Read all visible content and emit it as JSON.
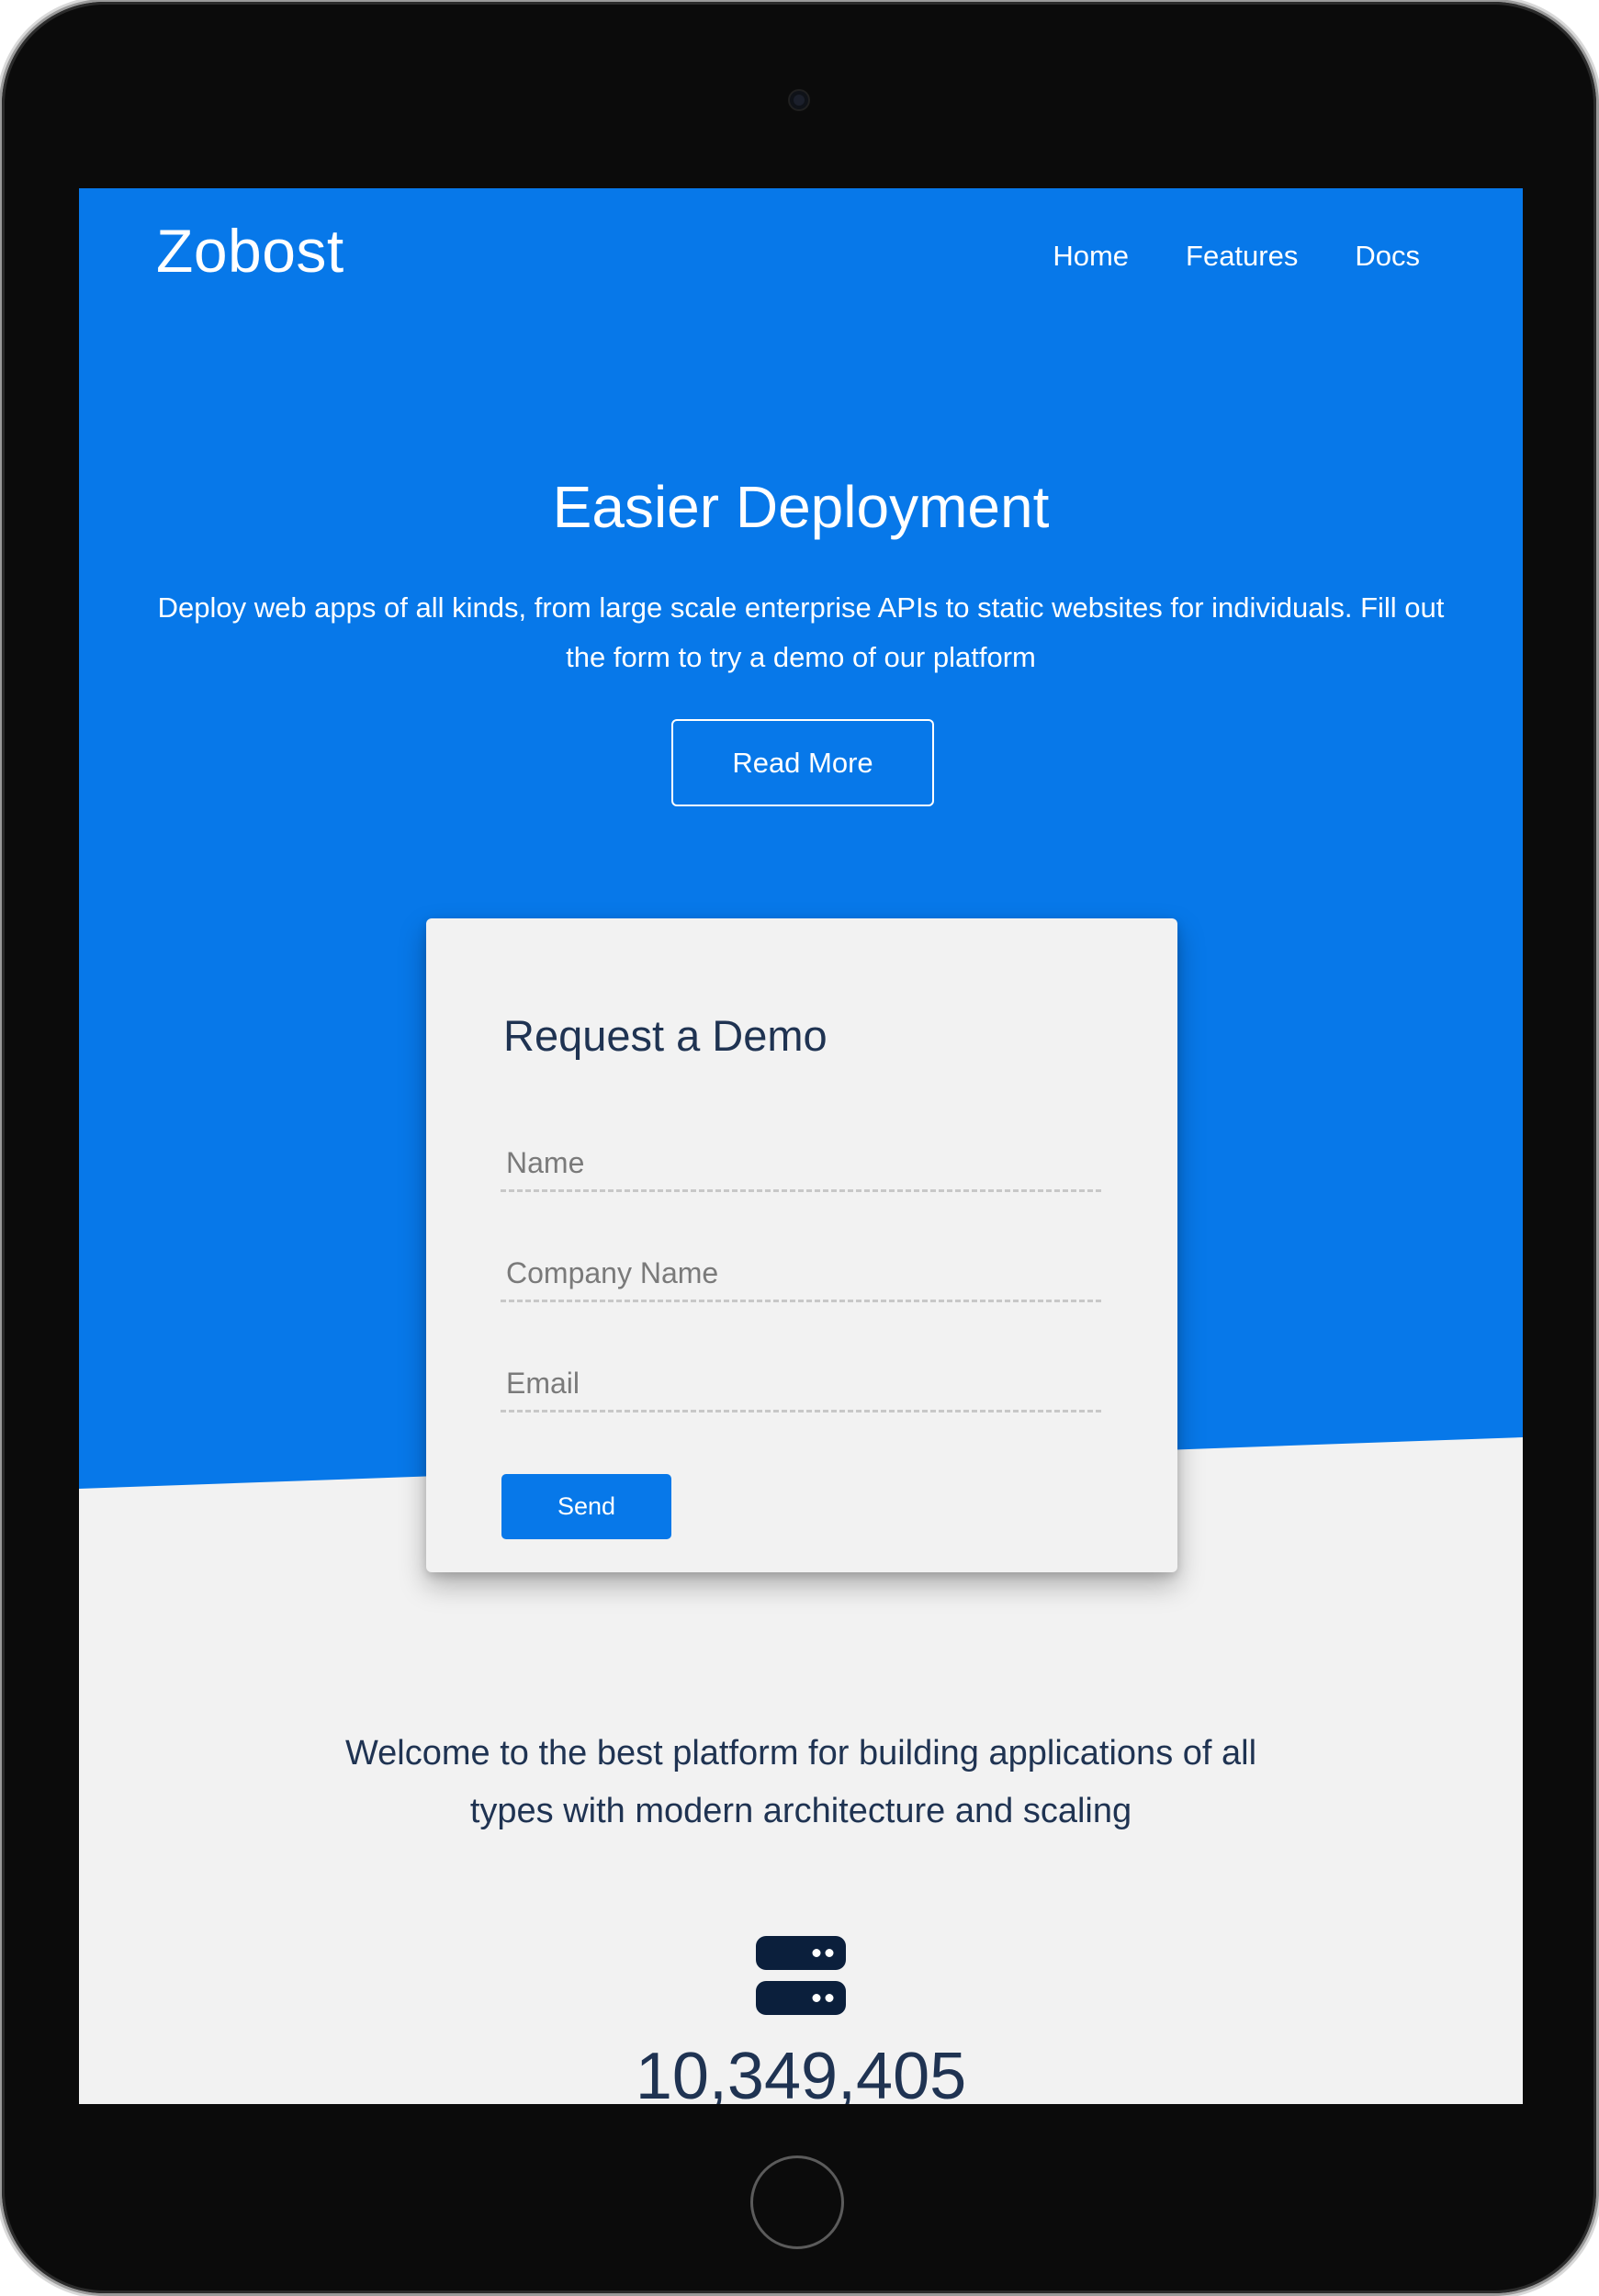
{
  "brand": {
    "name": "Zobost"
  },
  "nav": {
    "items": [
      {
        "label": "Home"
      },
      {
        "label": "Features"
      },
      {
        "label": "Docs"
      }
    ]
  },
  "hero": {
    "title": "Easier Deployment",
    "subtitle": "Deploy web apps of all kinds, from large scale enterprise APIs to static websites for individuals. Fill out the form to try a demo of our platform",
    "cta_label": "Read More"
  },
  "demo_form": {
    "title": "Request a Demo",
    "fields": {
      "name": {
        "placeholder": "Name",
        "value": ""
      },
      "company": {
        "placeholder": "Company Name",
        "value": ""
      },
      "email": {
        "placeholder": "Email",
        "value": ""
      }
    },
    "submit_label": "Send"
  },
  "welcome": {
    "text": "Welcome to the best platform for building applications of all types with modern architecture and scaling"
  },
  "stats": {
    "icon": "server-icon",
    "value": "10,349,405"
  },
  "colors": {
    "primary": "#0778e9",
    "page_background": "#f2f2f2",
    "heading_text": "#1f3352",
    "device_bezel": "#0b0b0b"
  }
}
